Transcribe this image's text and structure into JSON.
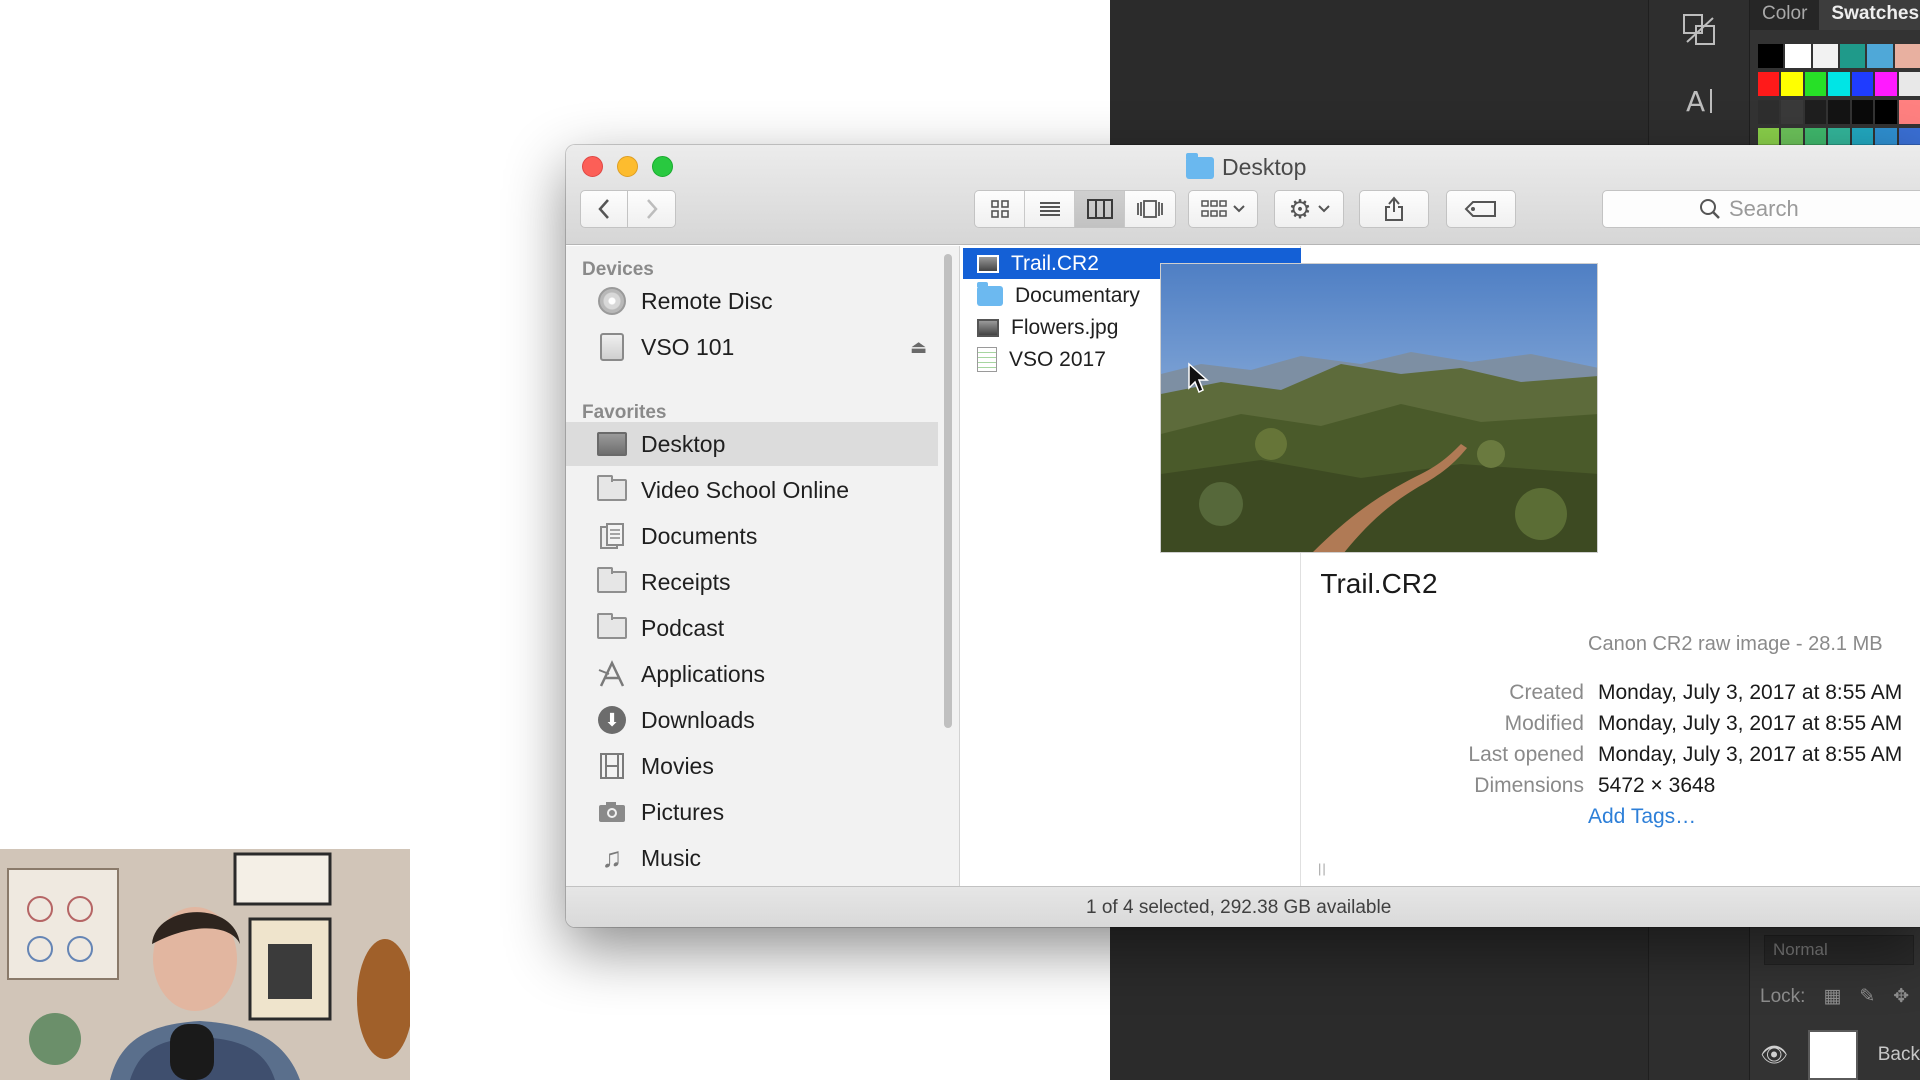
{
  "photoshop": {
    "tabs": [
      "Color",
      "Swatches"
    ],
    "tool_icons": [
      "transform-icon",
      "character-icon"
    ],
    "swatch_rows": [
      [
        "#000000",
        "#ffffff",
        "#f2f2f2",
        "#1f9a8a",
        "#4fa8d8",
        "#e8b0a0"
      ],
      [
        "#ff1a1a",
        "#ffff00",
        "#27e027",
        "#00e5e5",
        "#1f3cff",
        "#ff1aff",
        "#e8e8e8"
      ],
      [
        "#2e2e2e",
        "#3a3a3a",
        "#1f1f1f",
        "#141414",
        "#0a0a0a",
        "#000000",
        "#ff8080"
      ],
      [
        "#8ad04a",
        "#6cc25a",
        "#3fb86c",
        "#33b59a",
        "#22a8c0",
        "#2f8fd0",
        "#3a6fd4"
      ]
    ],
    "blend_mode": "Normal",
    "lock_label": "Lock:",
    "layer_name": "Back"
  },
  "window": {
    "title": "Desktop"
  },
  "toolbar": {
    "view_buttons": [
      "icon-view",
      "list-view",
      "column-view",
      "cover-flow-view"
    ],
    "active_view": "column-view",
    "search_placeholder": "Search"
  },
  "sidebar": {
    "sections": [
      {
        "header": "Devices"
      },
      {
        "header": "Favorites"
      }
    ],
    "devices": [
      {
        "label": "Remote Disc",
        "icon": "disc-icon"
      },
      {
        "label": "VSO 101",
        "icon": "drive-icon",
        "ejectable": true
      }
    ],
    "favorites": [
      {
        "label": "Desktop",
        "icon": "desktop-icon",
        "selected": true
      },
      {
        "label": "Video School Online",
        "icon": "folder-icon"
      },
      {
        "label": "Documents",
        "icon": "documents-icon"
      },
      {
        "label": "Receipts",
        "icon": "folder-icon"
      },
      {
        "label": "Podcast",
        "icon": "folder-icon"
      },
      {
        "label": "Applications",
        "icon": "applications-icon"
      },
      {
        "label": "Downloads",
        "icon": "downloads-icon"
      },
      {
        "label": "Movies",
        "icon": "movies-icon"
      },
      {
        "label": "Pictures",
        "icon": "pictures-icon"
      },
      {
        "label": "Music",
        "icon": "music-icon"
      }
    ]
  },
  "column": {
    "items": [
      {
        "label": "Trail.CR2",
        "icon": "image-file-icon",
        "selected": true
      },
      {
        "label": "Documentary",
        "icon": "folder-icon",
        "has_children": true
      },
      {
        "label": "Flowers.jpg",
        "icon": "image-file-icon"
      },
      {
        "label": "VSO 2017",
        "icon": "spreadsheet-file-icon"
      }
    ]
  },
  "preview": {
    "name": "Trail.CR2",
    "kind": "Canon CR2 raw image - 28.1 MB",
    "meta": [
      {
        "label": "Created",
        "value": "Monday, July 3, 2017 at 8:55 AM"
      },
      {
        "label": "Modified",
        "value": "Monday, July 3, 2017 at 8:55 AM"
      },
      {
        "label": "Last opened",
        "value": "Monday, July 3, 2017 at 8:55 AM"
      },
      {
        "label": "Dimensions",
        "value": "5472 × 3648"
      }
    ],
    "add_tags": "Add Tags…"
  },
  "status": {
    "text": "1 of 4 selected, 292.38 GB available"
  },
  "colors": {
    "selection": "#1460d6",
    "sidebar_selected": "#dcdcdc",
    "link": "#2d7fd8"
  }
}
